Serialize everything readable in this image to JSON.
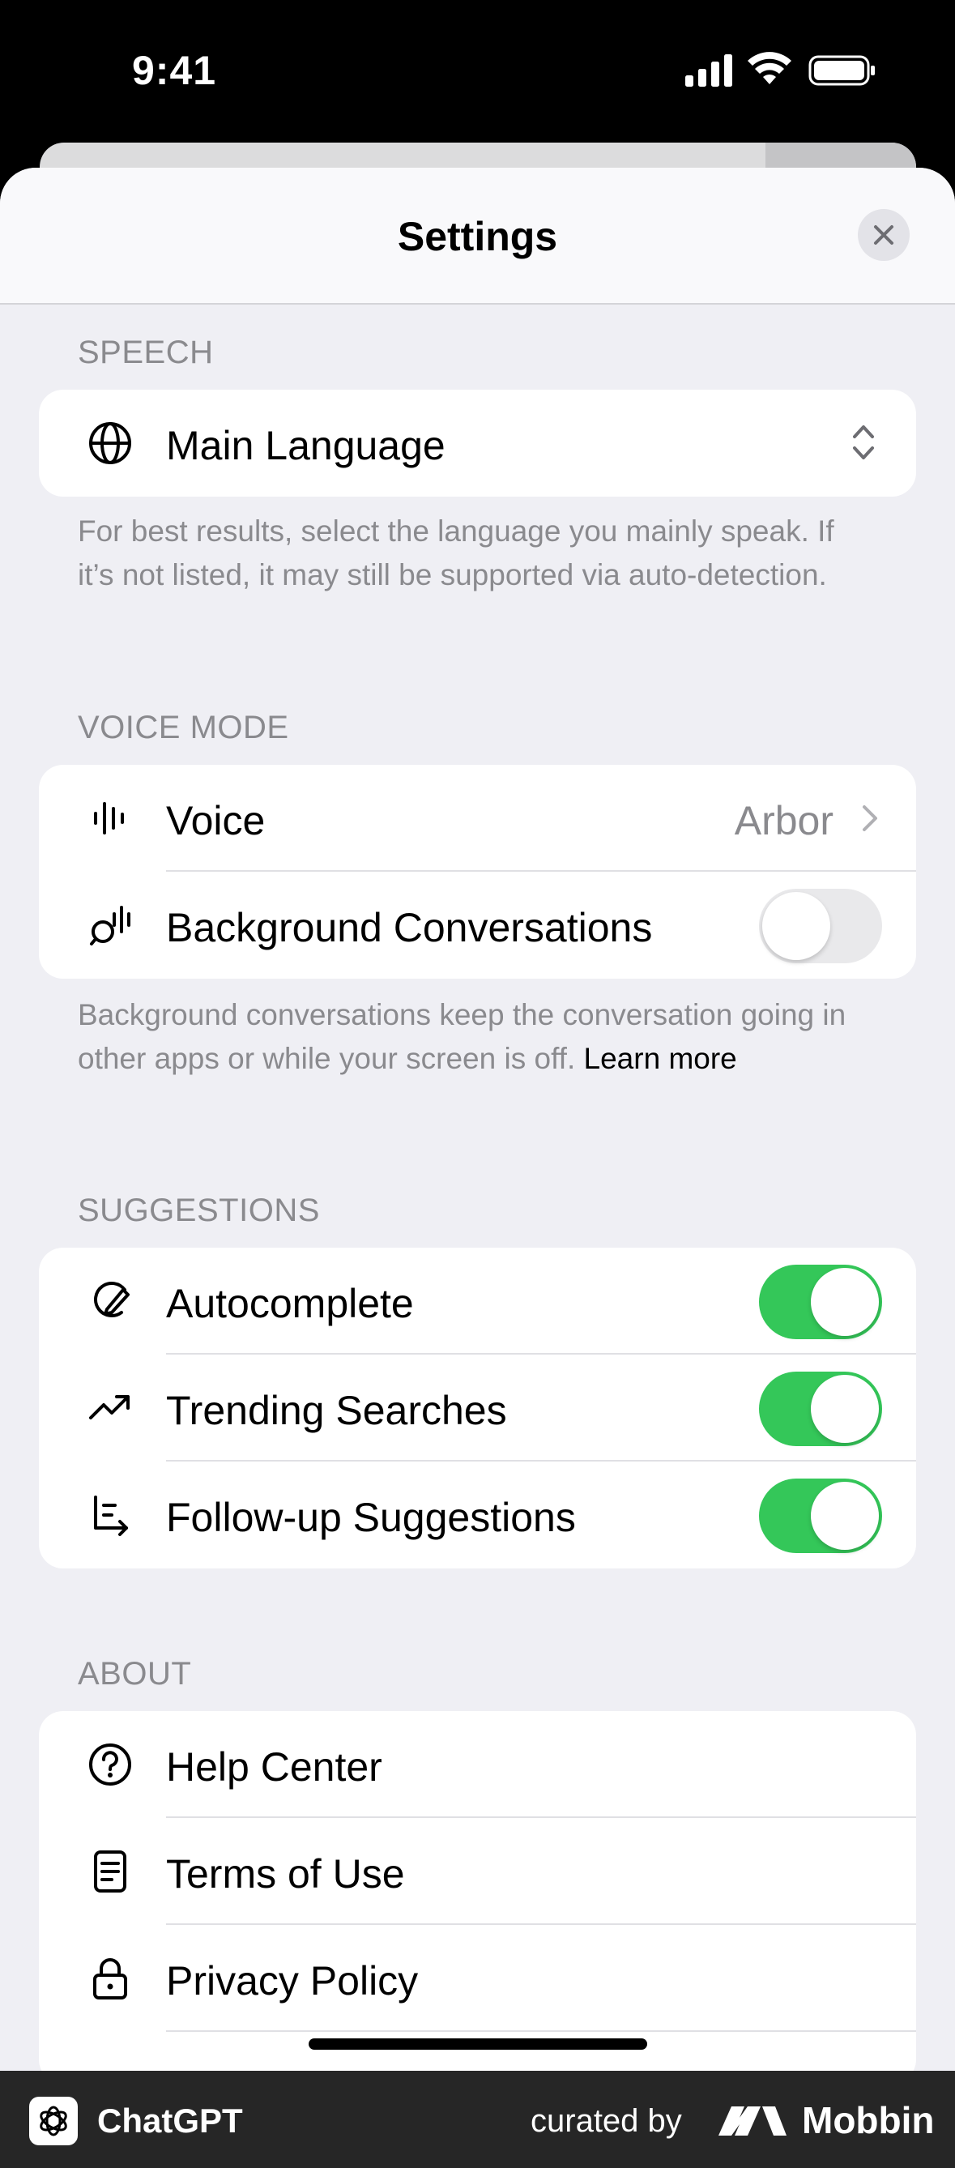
{
  "status_bar": {
    "time": "9:41"
  },
  "header": {
    "title": "Settings"
  },
  "sections": {
    "speech": {
      "heading": "SPEECH",
      "main_language_label": "Main Language",
      "note": "For best results, select the language you mainly speak. If it’s not listed, it may still be supported via auto-detection."
    },
    "voice_mode": {
      "heading": "VOICE MODE",
      "voice_label": "Voice",
      "voice_value": "Arbor",
      "background_label": "Background Conversations",
      "background_enabled": false,
      "note": "Background conversations keep the conversation going in other apps or while your screen is off.",
      "note_link": "Learn more"
    },
    "suggestions": {
      "heading": "SUGGESTIONS",
      "autocomplete_label": "Autocomplete",
      "autocomplete_enabled": true,
      "trending_label": "Trending Searches",
      "trending_enabled": true,
      "followup_label": "Follow-up Suggestions",
      "followup_enabled": true
    },
    "about": {
      "heading": "ABOUT",
      "help_label": "Help Center",
      "terms_label": "Terms of Use",
      "privacy_label": "Privacy Policy"
    }
  },
  "footer": {
    "app_name": "ChatGPT",
    "curated_by": "curated by",
    "brand": "Mobbin"
  },
  "colors": {
    "toggle_on": "#34c759",
    "toggle_off": "#e9e9eb",
    "background": "#efeff4"
  }
}
